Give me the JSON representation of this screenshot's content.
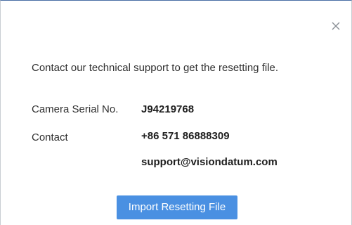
{
  "dialog": {
    "close_icon": "close-icon",
    "message": "Contact our technical support to get the resetting file.",
    "serial_label": "Camera Serial No.",
    "serial_value": "J94219768",
    "contact_label": "Contact",
    "phone": "+86 571 86888309",
    "email": "support@visiondatum.com",
    "import_button_label": "Import Resetting File",
    "colors": {
      "accent": "#4a90e2",
      "text": "#303030",
      "top_border": "#4a6fa5"
    }
  }
}
